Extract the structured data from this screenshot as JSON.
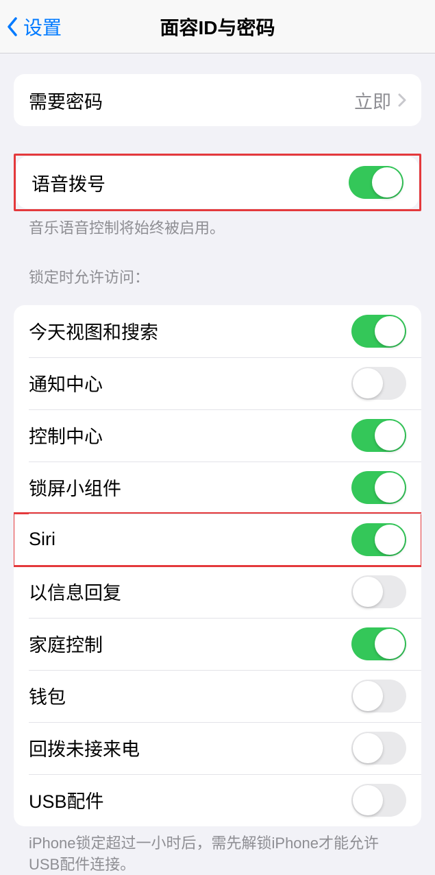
{
  "header": {
    "back_label": "设置",
    "title": "面容ID与密码"
  },
  "require_passcode": {
    "label": "需要密码",
    "value": "立即"
  },
  "voice_dial": {
    "label": "语音拨号",
    "enabled": true,
    "footer": "音乐语音控制将始终被启用。"
  },
  "lock_access": {
    "section_title": "锁定时允许访问：",
    "items": [
      {
        "label": "今天视图和搜索",
        "enabled": true
      },
      {
        "label": "通知中心",
        "enabled": false
      },
      {
        "label": "控制中心",
        "enabled": true
      },
      {
        "label": "锁屏小组件",
        "enabled": true
      },
      {
        "label": "Siri",
        "enabled": true
      },
      {
        "label": "以信息回复",
        "enabled": false
      },
      {
        "label": "家庭控制",
        "enabled": true
      },
      {
        "label": "钱包",
        "enabled": false
      },
      {
        "label": "回拨未接来电",
        "enabled": false
      },
      {
        "label": "USB配件",
        "enabled": false
      }
    ],
    "footer": "iPhone锁定超过一小时后，需先解锁iPhone才能允许USB配件连接。"
  }
}
